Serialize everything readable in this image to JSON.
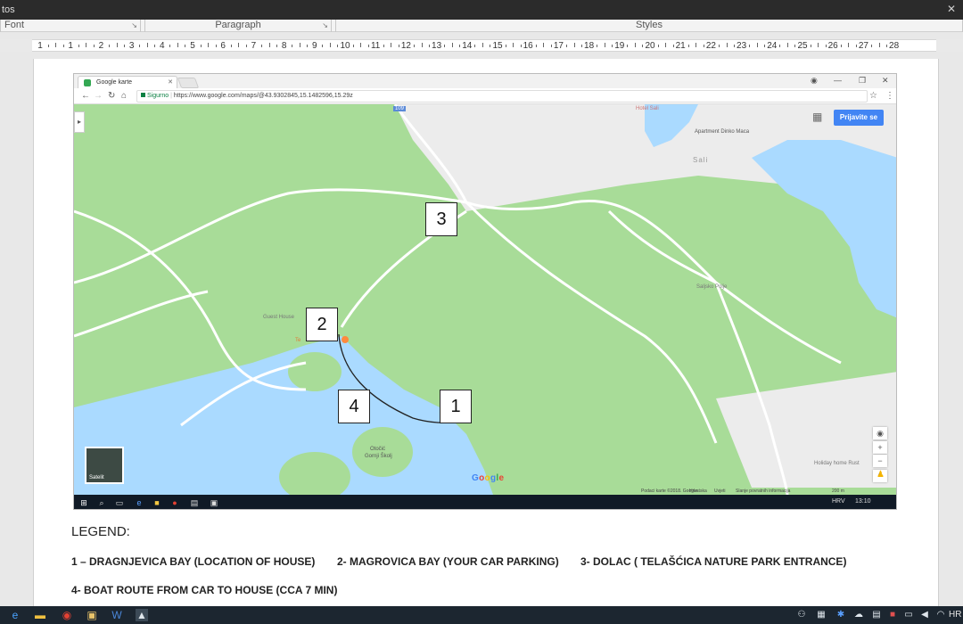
{
  "window": {
    "title": "tos",
    "close_glyph": "✕"
  },
  "ribbon": {
    "font_label": "Font",
    "paragraph_label": "Paragraph",
    "styles_label": "Styles"
  },
  "ruler": {
    "labels": [
      "1",
      "1",
      "2",
      "3",
      "4",
      "5",
      "6",
      "7",
      "8",
      "9",
      "10",
      "11",
      "12",
      "13",
      "14",
      "15",
      "16",
      "17",
      "18",
      "19",
      "20",
      "21",
      "22",
      "23",
      "24",
      "25",
      "26",
      "27",
      "28"
    ]
  },
  "browser": {
    "tab_title": "Google karte",
    "address_secure": "Sigurno",
    "address_url": "https://www.google.com/maps/@43.9302845,15.1482596,15.29z",
    "sign_in": "Prijavite se"
  },
  "map": {
    "labels": {
      "road_num": "109",
      "hotel_top": "Hotel Sali",
      "apartment": "Apartment Dinko Maca",
      "sali": "Sali",
      "saljsko_polje": "Saljsko Polje",
      "guest_house": "Guest House",
      "telascica": "Te",
      "otocic": "Otočić",
      "gornji_skoljic": "Gornji Školj",
      "holiday_home": "Holiday home Rust",
      "satelit": "Satelit",
      "google": "Google"
    },
    "markers": {
      "m1": "1",
      "m2": "2",
      "m3": "3",
      "m4": "4"
    },
    "footer": {
      "data": "Podaci karte ©2018. Google",
      "country": "Hrvatska",
      "terms": "Uvjeti",
      "report": "Slanje povratnih informacija",
      "scale": "200 m"
    }
  },
  "inner_taskbar": {
    "lang": "HRV",
    "time": "13:10"
  },
  "legend": {
    "title": "LEGEND:",
    "item1": "1 – DRAGNJEVICA BAY (LOCATION OF HOUSE)",
    "item2": "2- MAGROVICA BAY (YOUR CAR PARKING)",
    "item3": "3- DOLAC ( TELAŠĆICA NATURE PARK ENTRANCE)",
    "item4": "4- BOAT ROUTE FROM CAR TO HOUSE (CCA  7 MIN)"
  },
  "taskbar": {
    "lang": "HR"
  },
  "colors": {
    "land": "#a8dc98",
    "water": "#aadaff",
    "urban": "#ececec",
    "road": "#ffffff",
    "accent": "#4285f4"
  }
}
